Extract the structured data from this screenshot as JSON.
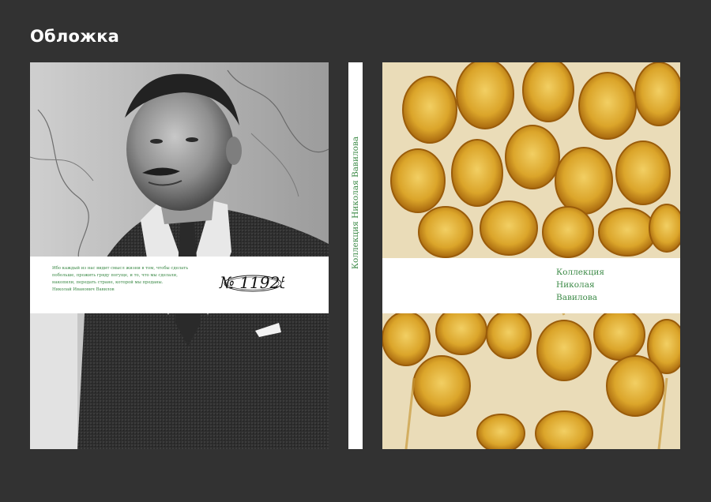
{
  "heading": "Обложка",
  "back_cover": {
    "quote_lines": [
      "Ибо каждый из нас видит смысл жизни в том, чтобы сделать",
      "побольше, прожить гряду погуще, и то, что мы сделали,",
      "накопили, передать стране, которой мы преданы.",
      "Николай Иванович Вавилов"
    ],
    "stamp_text": "№ 11925"
  },
  "spine": {
    "title": "Коллекция Николая Вавилова"
  },
  "front_cover": {
    "title_lines": [
      "Коллекция",
      "Николая",
      "Вавилова"
    ]
  },
  "colors": {
    "background": "#323232",
    "accent_green": "#3c8a47",
    "amber": "#d9a021"
  }
}
